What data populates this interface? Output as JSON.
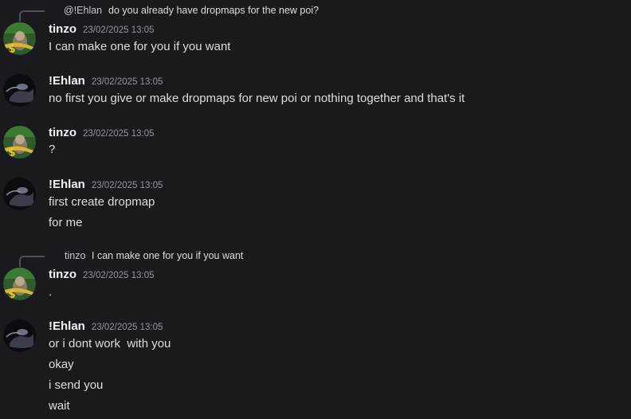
{
  "colors": {
    "background": "#1a1a1e",
    "author": "#f2f3f5",
    "message": "#dbdee1",
    "timestamp": "#94959c",
    "reply_spine": "#4e5058"
  },
  "messages": [
    {
      "reply": {
        "mention": "@!Ehlan",
        "text": "do you already have dropmaps for the new poi?",
        "avatar_icon": "ehlan-avatar-icon"
      },
      "author": "tinzo",
      "timestamp": "23/02/2025 13:05",
      "avatar_icon": "tinzo-avatar-icon",
      "lines": [
        "I can make one for you if you want"
      ]
    },
    {
      "author": "!Ehlan",
      "timestamp": "23/02/2025 13:05",
      "avatar_icon": "ehlan-avatar-icon",
      "lines": [
        "no first you give or make dropmaps for new poi or nothing together and that's it"
      ]
    },
    {
      "author": "tinzo",
      "timestamp": "23/02/2025 13:05",
      "avatar_icon": "tinzo-avatar-icon",
      "lines": [
        "?"
      ]
    },
    {
      "author": "!Ehlan",
      "timestamp": "23/02/2025 13:05",
      "avatar_icon": "ehlan-avatar-icon",
      "lines": [
        "first create dropmap",
        "for me"
      ]
    },
    {
      "reply": {
        "mention": "tinzo",
        "text": "I can make one for you if you want",
        "avatar_icon": "tinzo-avatar-icon"
      },
      "author": "tinzo",
      "timestamp": "23/02/2025 13:05",
      "avatar_icon": "tinzo-avatar-icon",
      "lines": [
        "."
      ]
    },
    {
      "author": "!Ehlan",
      "timestamp": "23/02/2025 13:05",
      "avatar_icon": "ehlan-avatar-icon",
      "lines": [
        "or i dont work  with you",
        "okay",
        "i send you",
        "wait"
      ]
    }
  ]
}
